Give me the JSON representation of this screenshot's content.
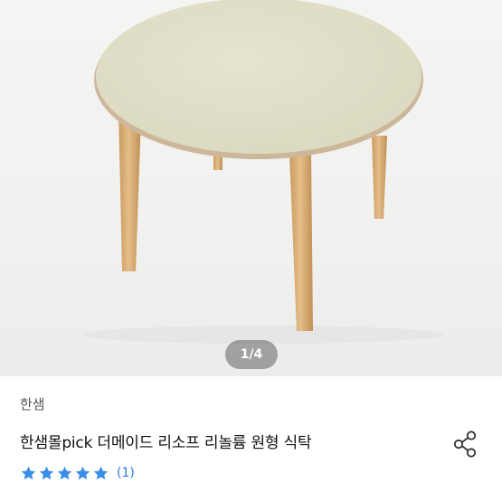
{
  "product": {
    "image_alt": "round table product photo",
    "pager": "1/4",
    "brand": "한샘",
    "title": "한샘몰pick 더메이드 리소프 리놀륨 원형 식탁",
    "rating": {
      "value": 5,
      "max": 5,
      "count_label": "(1)"
    },
    "share_icon": "share-icon",
    "star_icon": "star-icon"
  },
  "colors": {
    "star": "#3a8ee6",
    "rating_count": "#2d7dd8",
    "table_top": "#e2e0c8",
    "table_edge": "#cdb79b",
    "wood": "#d9b07a"
  }
}
